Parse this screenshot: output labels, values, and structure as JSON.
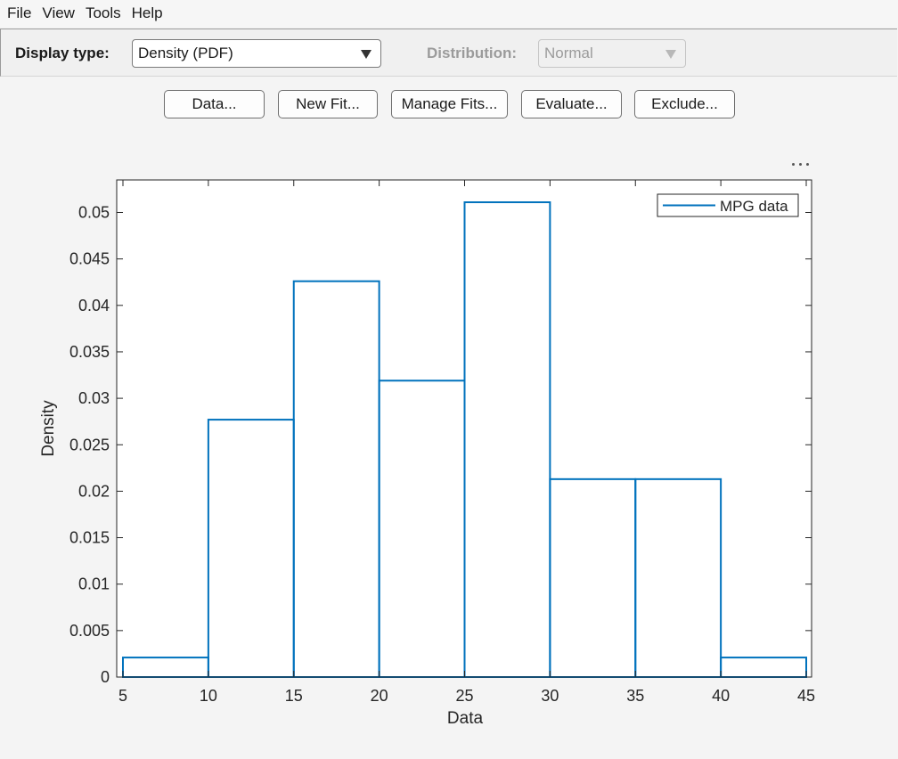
{
  "menubar": {
    "items": [
      "File",
      "View",
      "Tools",
      "Help"
    ]
  },
  "toolbar": {
    "display_type_label": "Display type:",
    "display_type_value": "Density (PDF)",
    "distribution_label": "Distribution:",
    "distribution_value": "Normal"
  },
  "buttons": {
    "data": "Data...",
    "new_fit": "New Fit...",
    "manage_fits": "Manage Fits...",
    "evaluate": "Evaluate...",
    "exclude": "Exclude..."
  },
  "colors": {
    "series": "#0072BD",
    "axes": "#262626"
  },
  "icons": {
    "more": "more-options-icon"
  },
  "chart_data": {
    "type": "bar",
    "xlabel": "Data",
    "ylabel": "Density",
    "xlim": [
      5,
      45
    ],
    "ylim": [
      0,
      0.0535
    ],
    "xticks": [
      "5",
      "10",
      "15",
      "20",
      "25",
      "30",
      "35",
      "40",
      "45"
    ],
    "yticks": [
      "0",
      "0.005",
      "0.01",
      "0.015",
      "0.02",
      "0.025",
      "0.03",
      "0.035",
      "0.04",
      "0.045",
      "0.05"
    ],
    "grid": false,
    "legend_position": "top-right",
    "series": [
      {
        "name": "MPG data",
        "bin_edges": [
          5,
          10,
          15,
          20,
          25,
          30,
          35,
          40,
          45
        ],
        "values": [
          0.0021,
          0.0277,
          0.0426,
          0.0319,
          0.0511,
          0.0213,
          0.0213,
          0.0021
        ]
      }
    ]
  }
}
